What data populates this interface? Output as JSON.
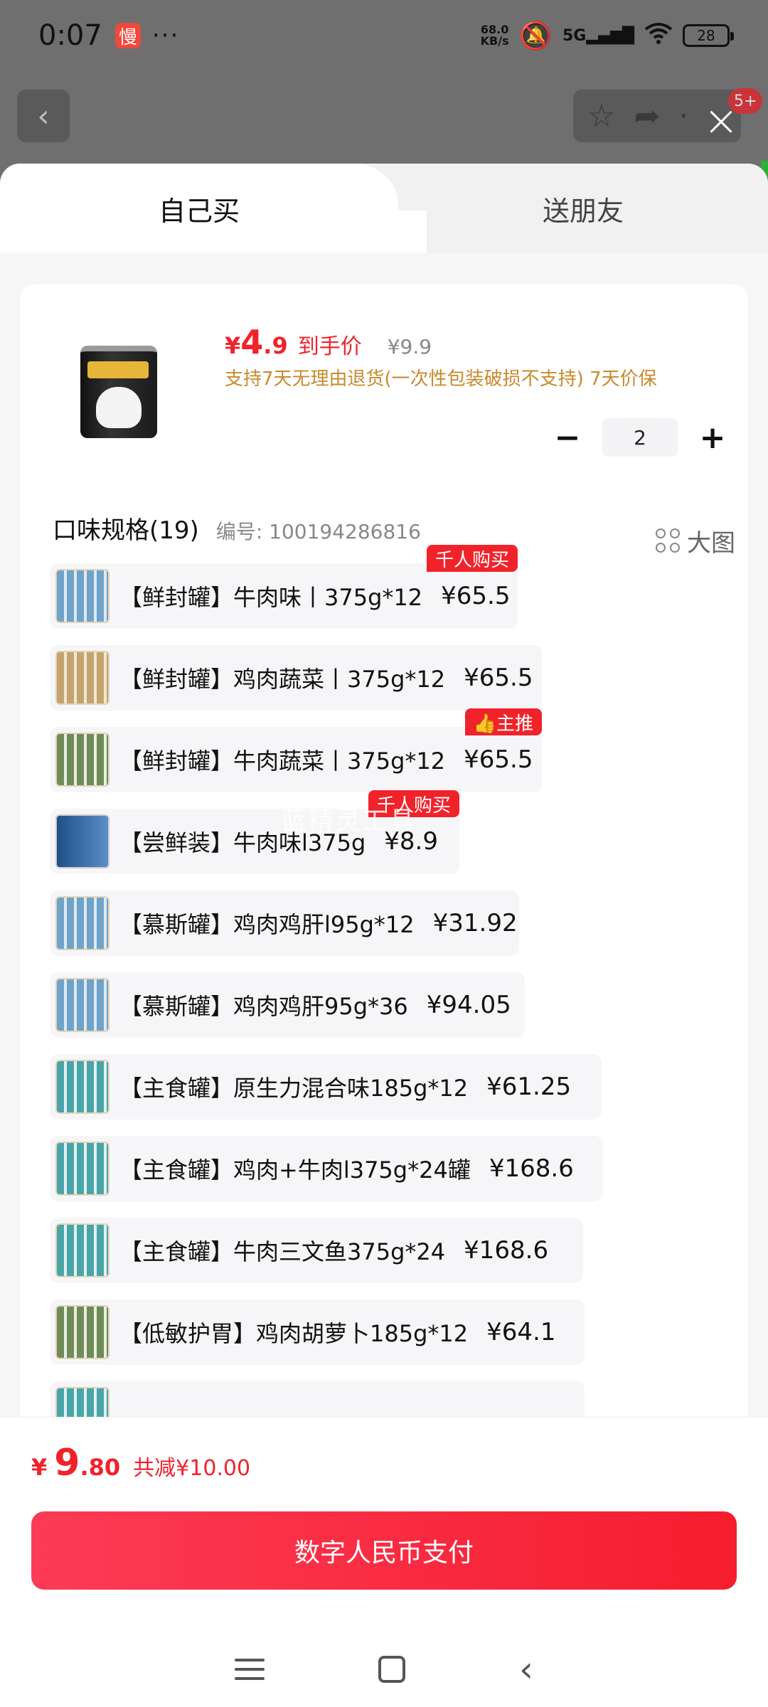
{
  "status": {
    "time": "0:07",
    "app_badge": "慢",
    "dots": "···",
    "speed_top": "68.0",
    "speed_unit": "KB/s",
    "network": "5G",
    "battery": "28"
  },
  "header": {
    "notif_count": "5+"
  },
  "tabs": {
    "self_buy": "自己买",
    "gift": "送朋友"
  },
  "product": {
    "price_symbol": "¥",
    "price_int": "4",
    "price_dec": ".9",
    "price_label": "到手价",
    "original_price": "¥9.9",
    "support_text": "支持7天无理由退货(一次性包装破损不支持) 7天价保",
    "quantity": "2"
  },
  "spec": {
    "title": "口味规格(19)",
    "code": "编号: 100194286816",
    "big_view": "大图",
    "items": [
      {
        "name": "【鲜封罐】牛肉味丨375g*12",
        "price": "¥65.5",
        "tag": "千人购买"
      },
      {
        "name": "【鲜封罐】鸡肉蔬菜丨375g*12",
        "price": "¥65.5",
        "tag": ""
      },
      {
        "name": "【鲜封罐】牛肉蔬菜丨375g*12",
        "price": "¥65.5",
        "tag": "👍主推"
      },
      {
        "name": "【尝鲜装】牛肉味l375g",
        "price": "¥8.9",
        "tag": "千人购买"
      },
      {
        "name": "【慕斯罐】鸡肉鸡肝l95g*12",
        "price": "¥31.92",
        "tag": ""
      },
      {
        "name": "【慕斯罐】鸡肉鸡肝95g*36",
        "price": "¥94.05",
        "tag": ""
      },
      {
        "name": "【主食罐】原生力混合味185g*12",
        "price": "¥61.25",
        "tag": ""
      },
      {
        "name": "【主食罐】鸡肉+牛肉l375g*24罐",
        "price": "¥168.6",
        "tag": ""
      },
      {
        "name": "【主食罐】牛肉三文鱼375g*24",
        "price": "¥168.6",
        "tag": ""
      },
      {
        "name": "【低敏护胃】鸡肉胡萝卜185g*12",
        "price": "¥64.1",
        "tag": ""
      }
    ]
  },
  "watermark": "蓝精灵工具",
  "footer": {
    "total_symbol": "¥",
    "total_int": "9",
    "total_dec": ".80",
    "savings": "共减¥10.00",
    "pay_label": "数字人民币支付"
  }
}
